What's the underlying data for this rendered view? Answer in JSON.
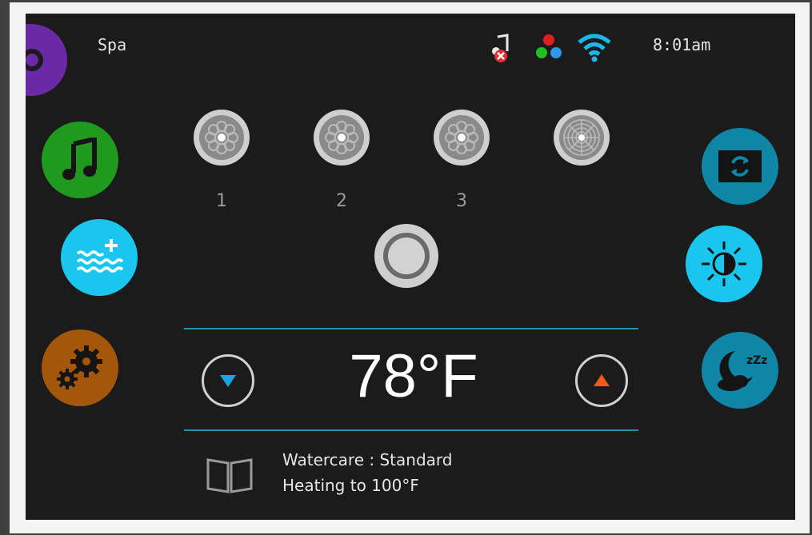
{
  "header": {
    "title": "Spa",
    "time": "8:01am"
  },
  "status_icons": [
    "music-muted-icon",
    "rgb-lights-icon",
    "wifi-icon"
  ],
  "left_buttons": [
    {
      "name": "music",
      "color": "#1f9a1f"
    },
    {
      "name": "water-fill",
      "color": "#19c6f0"
    },
    {
      "name": "settings",
      "color": "#a4570b"
    }
  ],
  "right_buttons": [
    {
      "name": "display-refresh",
      "color": "#0f86a6"
    },
    {
      "name": "brightness",
      "color": "#19c6f0"
    },
    {
      "name": "sleep",
      "color": "#0f86a6"
    }
  ],
  "jets": [
    {
      "label": "1"
    },
    {
      "label": "2"
    },
    {
      "label": "3"
    },
    {
      "label": ""
    }
  ],
  "temperature": {
    "value": "78°F",
    "down_color": "#1aa6e0",
    "up_color": "#f05a14"
  },
  "status": {
    "line1": "Watercare : Standard",
    "line2": "Heating to 100°F"
  },
  "colors": {
    "accent_rule": "#2a8ea6",
    "screen_bg": "#1b1b1b",
    "purple": "#6a2aa6"
  }
}
